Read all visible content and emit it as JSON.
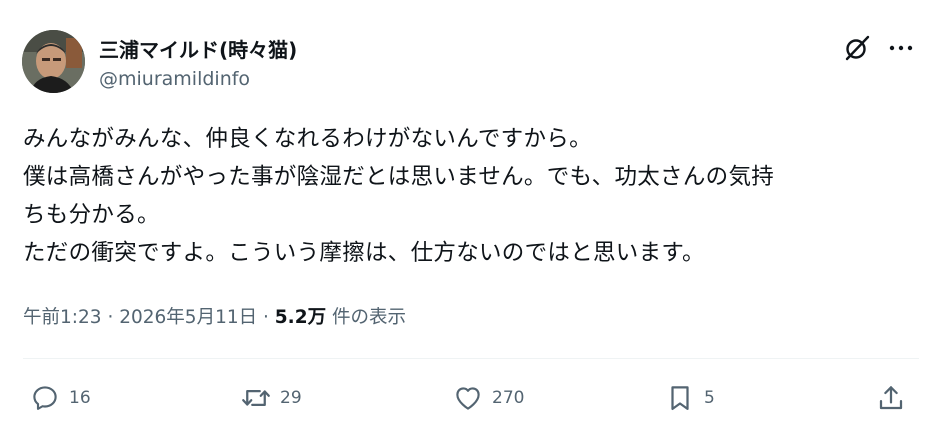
{
  "tweet": {
    "author_name": "三浦マイルド(時々猫)",
    "author_handle": "@miuramildinfo",
    "text_lines": [
      "みんながみんな、仲良くなれるわけがないんですから。",
      "僕は高橋さんがやった事が陰湿だとは思いません。でも、功太さんの気持",
      "ちも分かる。",
      "ただの衝突ですよ。こういう摩擦は、仕方ないのではと思います。"
    ],
    "time": "午前1:23",
    "date": "2026年5月11日",
    "sep": "·",
    "views_count": "5.2万",
    "views_label": "件の表示"
  },
  "actions": {
    "replies": "16",
    "reposts": "29",
    "likes": "270",
    "bookmarks": "5"
  },
  "icons": {
    "grok": "grok-icon",
    "more": "more-icon",
    "reply": "reply-icon",
    "repost": "repost-icon",
    "like": "heart-icon",
    "bookmark": "bookmark-icon",
    "share": "share-icon"
  }
}
